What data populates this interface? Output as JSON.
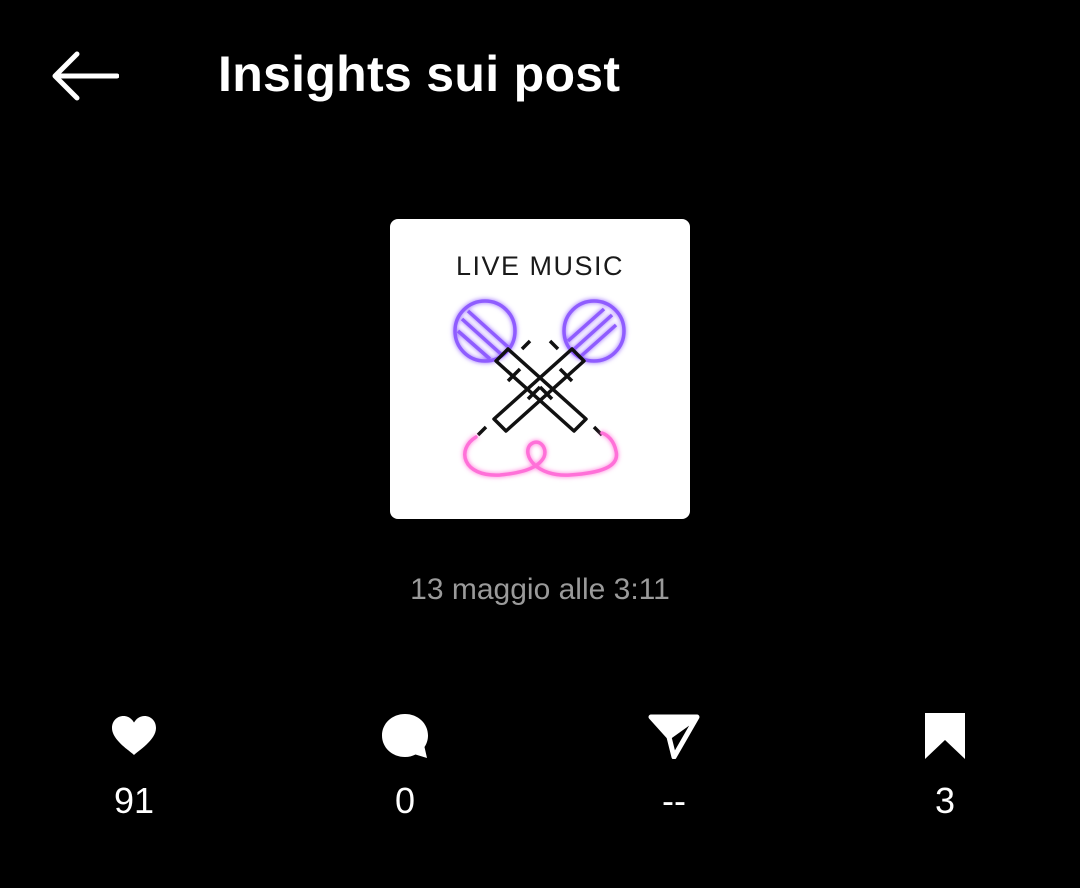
{
  "header": {
    "title": "Insights sui post",
    "back_icon": "arrow-left-icon"
  },
  "post": {
    "thumbnail_caption": "LIVE MUSIC",
    "date": "13 maggio alle 3:11"
  },
  "metrics": [
    {
      "icon": "heart-icon",
      "value": "91"
    },
    {
      "icon": "comment-icon",
      "value": "0"
    },
    {
      "icon": "send-icon",
      "value": "--"
    },
    {
      "icon": "bookmark-icon",
      "value": "3"
    }
  ],
  "colors": {
    "background": "#000000",
    "text": "#ffffff",
    "muted_text": "#9a9a9a",
    "neon_purple": "#8f5cff",
    "neon_pink": "#ff6fd8"
  }
}
